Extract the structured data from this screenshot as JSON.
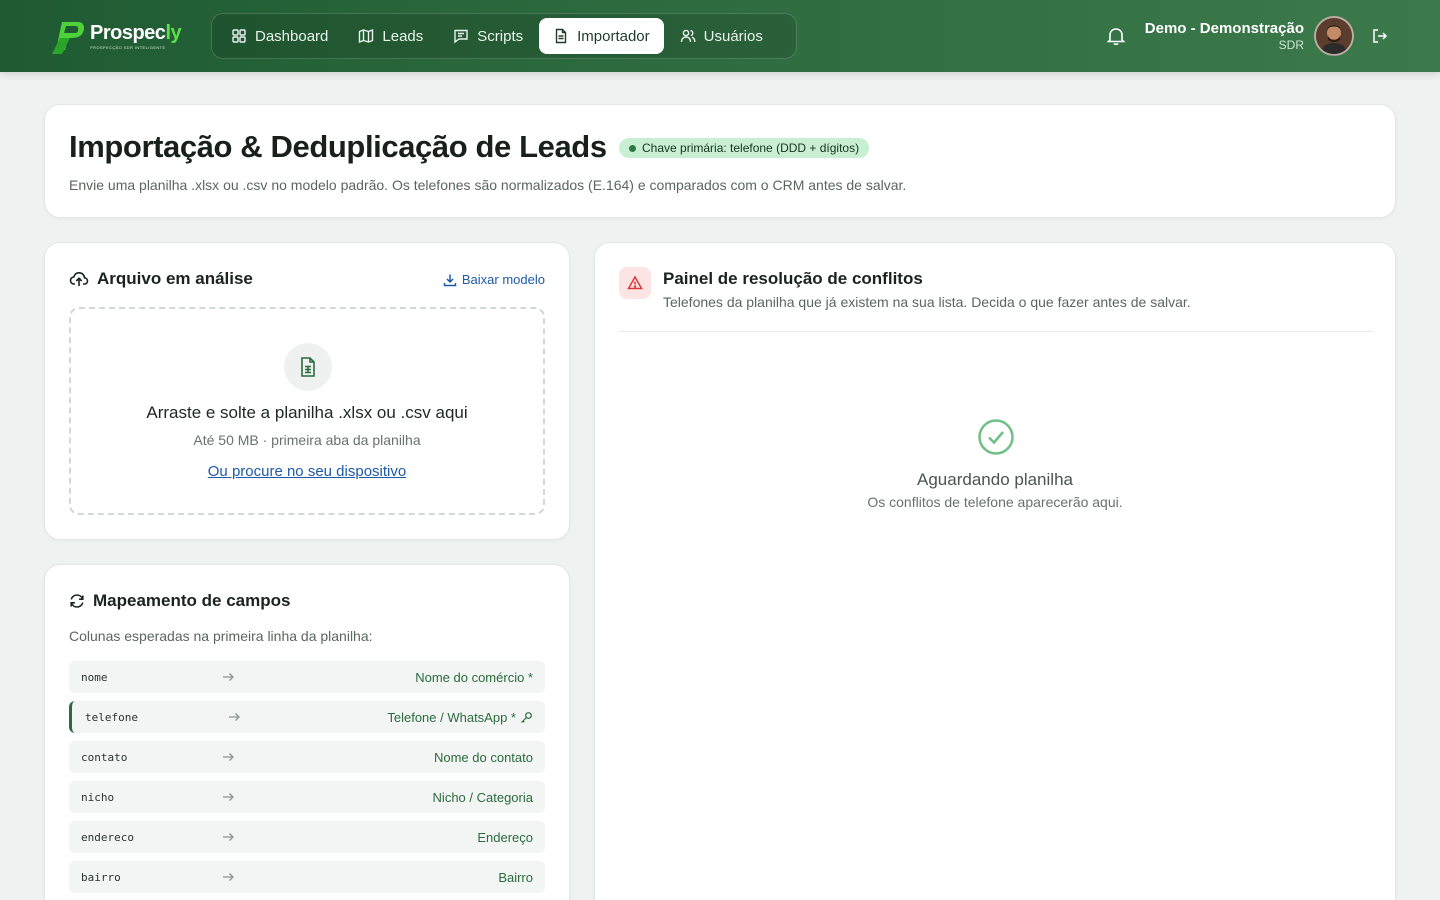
{
  "brand": {
    "name_main": "Prospec",
    "name_accent": "ly",
    "tagline": "Prospecção SDR inteligente",
    "accent_color": "#5fe04a",
    "primary_color": "#2d6b3f"
  },
  "nav": {
    "items": [
      {
        "label": "Dashboard",
        "icon": "grid-icon",
        "active": false
      },
      {
        "label": "Leads",
        "icon": "map-icon",
        "active": false
      },
      {
        "label": "Scripts",
        "icon": "message-icon",
        "active": false
      },
      {
        "label": "Importador",
        "icon": "file-icon",
        "active": true
      },
      {
        "label": "Usuários",
        "icon": "users-icon",
        "active": false
      }
    ]
  },
  "user": {
    "name": "Demo - Demonstração",
    "role": "SDR"
  },
  "hero": {
    "title": "Importação & Deduplicação de Leads",
    "badge": "Chave primária: telefone (DDD + dígitos)",
    "description": "Envie uma planilha .xlsx ou .csv no modelo padrão. Os telefones são normalizados (E.164) e comparados com o CRM antes de salvar."
  },
  "upload": {
    "title": "Arquivo em análise",
    "download_label": "Baixar modelo",
    "drop_title": "Arraste e solte a planilha .xlsx ou .csv aqui",
    "drop_sub": "Até 50 MB · primeira aba da planilha",
    "browse_label": "Ou procure no seu dispositivo"
  },
  "mapping": {
    "title": "Mapeamento de campos",
    "description": "Colunas esperadas na primeira linha da planilha:",
    "rows": [
      {
        "column": "nome",
        "target": "Nome do comércio *",
        "key": false
      },
      {
        "column": "telefone",
        "target": "Telefone / WhatsApp *",
        "key": true
      },
      {
        "column": "contato",
        "target": "Nome do contato",
        "key": false
      },
      {
        "column": "nicho",
        "target": "Nicho / Categoria",
        "key": false
      },
      {
        "column": "endereco",
        "target": "Endereço",
        "key": false
      },
      {
        "column": "bairro",
        "target": "Bairro",
        "key": false
      }
    ]
  },
  "conflicts": {
    "title": "Painel de resolução de conflitos",
    "description": "Telefones da planilha que já existem na sua lista. Decida o que fazer antes de salvar.",
    "empty_title": "Aguardando planilha",
    "empty_sub": "Os conflitos de telefone aparecerão aqui."
  }
}
